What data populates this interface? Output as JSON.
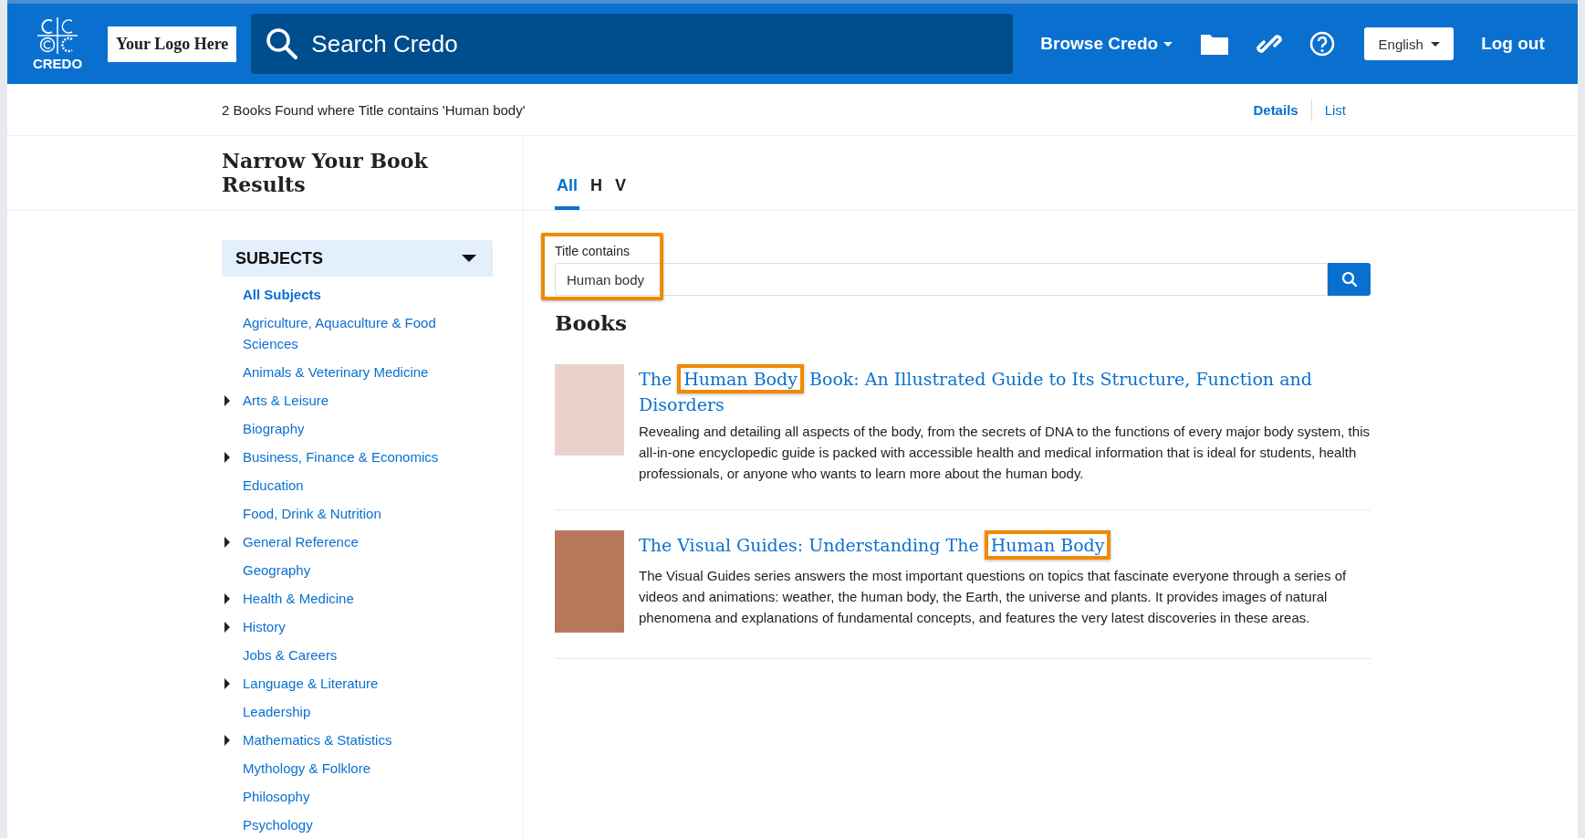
{
  "header": {
    "logo_text": "CREDO",
    "custom_logo": "Your Logo Here",
    "search": {
      "placeholder": "Search Credo"
    },
    "browse": "Browse Credo",
    "language": "English",
    "logout": "Log out"
  },
  "results_bar": {
    "summary": "2 Books Found where Title contains 'Human body'",
    "views": [
      {
        "label": "Details",
        "selected": true
      },
      {
        "label": "List",
        "selected": false
      }
    ]
  },
  "sidebar": {
    "title": "Narrow Your Book Results",
    "section": {
      "label": "SUBJECTS",
      "expanded": true
    },
    "items": [
      {
        "label": "All Subjects",
        "selected": true,
        "has_children": false
      },
      {
        "label": "Agriculture, Aquaculture & Food Sciences",
        "selected": false,
        "has_children": false
      },
      {
        "label": "Animals & Veterinary Medicine",
        "selected": false,
        "has_children": false
      },
      {
        "label": "Arts & Leisure",
        "selected": false,
        "has_children": true
      },
      {
        "label": "Biography",
        "selected": false,
        "has_children": false
      },
      {
        "label": "Business, Finance & Economics",
        "selected": false,
        "has_children": true
      },
      {
        "label": "Education",
        "selected": false,
        "has_children": false
      },
      {
        "label": "Food, Drink & Nutrition",
        "selected": false,
        "has_children": false
      },
      {
        "label": "General Reference",
        "selected": false,
        "has_children": true
      },
      {
        "label": "Geography",
        "selected": false,
        "has_children": false
      },
      {
        "label": "Health & Medicine",
        "selected": false,
        "has_children": true
      },
      {
        "label": "History",
        "selected": false,
        "has_children": true
      },
      {
        "label": "Jobs & Careers",
        "selected": false,
        "has_children": false
      },
      {
        "label": "Language & Literature",
        "selected": false,
        "has_children": true
      },
      {
        "label": "Leadership",
        "selected": false,
        "has_children": false
      },
      {
        "label": "Mathematics & Statistics",
        "selected": false,
        "has_children": true
      },
      {
        "label": "Mythology & Folklore",
        "selected": false,
        "has_children": false
      },
      {
        "label": "Philosophy",
        "selected": false,
        "has_children": false
      },
      {
        "label": "Psychology",
        "selected": false,
        "has_children": false
      }
    ]
  },
  "tabs": [
    {
      "label": "All",
      "selected": true
    },
    {
      "label": "H",
      "selected": false
    },
    {
      "label": "V",
      "selected": false
    }
  ],
  "filter": {
    "label": "Title contains",
    "value": "Human body",
    "highlighted": true
  },
  "books_heading": "Books",
  "books": [
    {
      "title_before": "The ",
      "title_highlight": "Human Body",
      "title_after": " Book: An Illustrated Guide to Its Structure, Function and Disorders",
      "description": "Revealing and detailing all aspects of the body, from the secrets of DNA to the functions of every major body system, this all-in-one encyclopedic guide is packed with accessible health and medical information that is ideal for students, health professionals, or anyone who wants to learn more about the human body."
    },
    {
      "title_before": "The Visual Guides: Understanding The ",
      "title_highlight": "Human Body",
      "description": "The Visual Guides series answers the most important questions on topics that fascinate everyone through a series of videos and animations: weather, the human body, the Earth, the universe and plants. It provides images of natural phenomena and explanations of fundamental concepts, and features the very latest discoveries in these areas."
    }
  ]
}
